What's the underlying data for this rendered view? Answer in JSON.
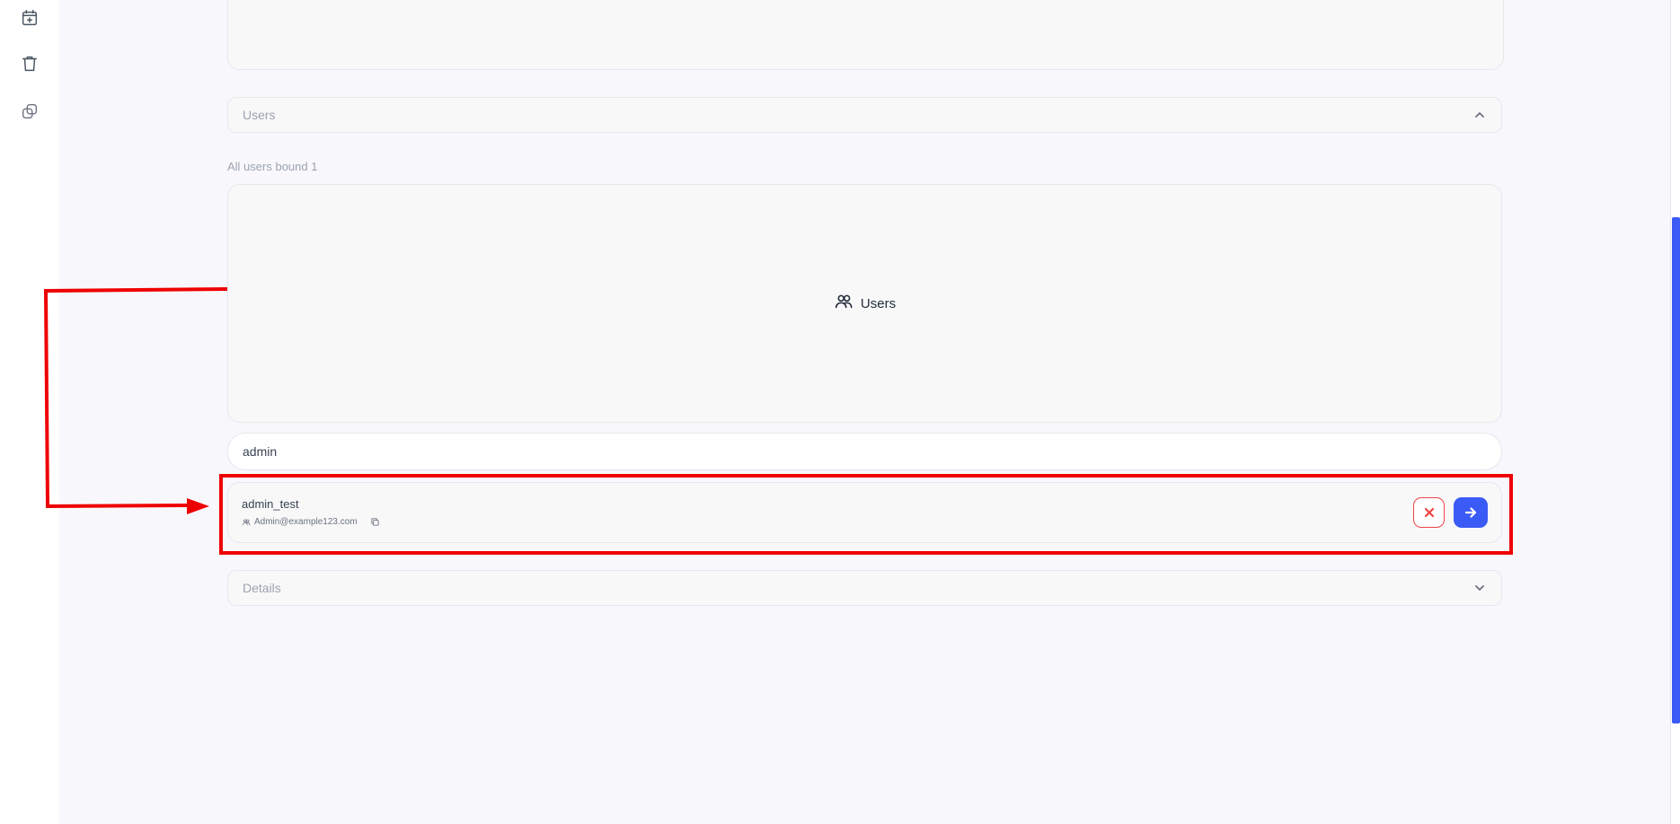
{
  "sidebar": {
    "icons": [
      {
        "name": "calendar-add-icon"
      },
      {
        "name": "trash-icon"
      },
      {
        "name": "duplicate-icon"
      }
    ]
  },
  "users_section": {
    "title": "Users",
    "bound_label": "All users bound 1",
    "drop_area_label": "Users"
  },
  "search": {
    "value": "admin"
  },
  "result": {
    "username": "admin_test",
    "email": "Admin@example123.com"
  },
  "details_section": {
    "title": "Details"
  },
  "colors": {
    "accent": "#3b5bf6",
    "danger": "#ef4444",
    "annotation": "#ef0000"
  }
}
